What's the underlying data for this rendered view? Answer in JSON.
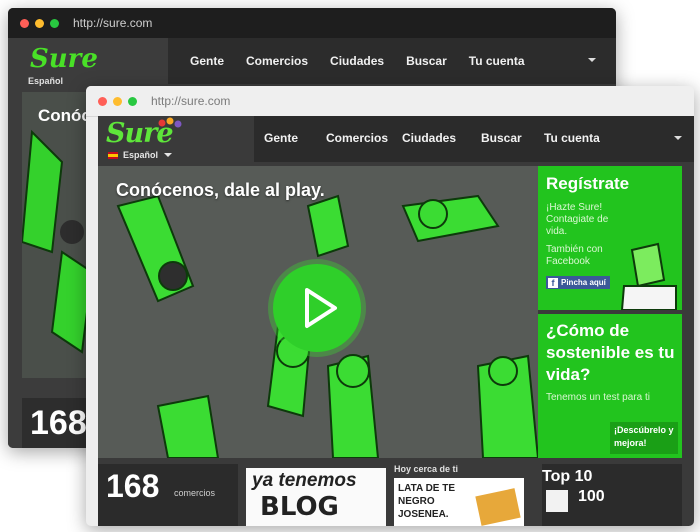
{
  "browser": {
    "url_back": "http://sure.com",
    "url_front": "http://sure.com"
  },
  "site": {
    "logo": "Sure",
    "language": "Español",
    "nav": [
      "Gente",
      "Comercios",
      "Ciudades",
      "Buscar",
      "Tu cuenta"
    ]
  },
  "hero": {
    "title": "Conócenos, dale al play."
  },
  "register": {
    "title": "Regístrate",
    "subtitle": "¡Hazte Sure! Contagiate de vida.",
    "facebook_line": "También con Facebook",
    "facebook_button": "Pincha aquí"
  },
  "test": {
    "title": "¿Cómo de sostenible es tu vida?",
    "subtitle": "Tenemos un test para ti",
    "button": "¡Descúbrelo y mejora!"
  },
  "bottom": {
    "stat_number": "168",
    "stat_label": "comercios",
    "blog_line1": "ya tenemos",
    "blog_line2": "BLOG",
    "near_heading": "Hoy cerca de ti",
    "near_item": "LATA DE TE NEGRO JOSENEA.",
    "top10_heading": "Top 10",
    "top10_value": "100"
  },
  "colors": {
    "brand_green": "#22c41e",
    "nav_dark": "#2b2b2b"
  }
}
